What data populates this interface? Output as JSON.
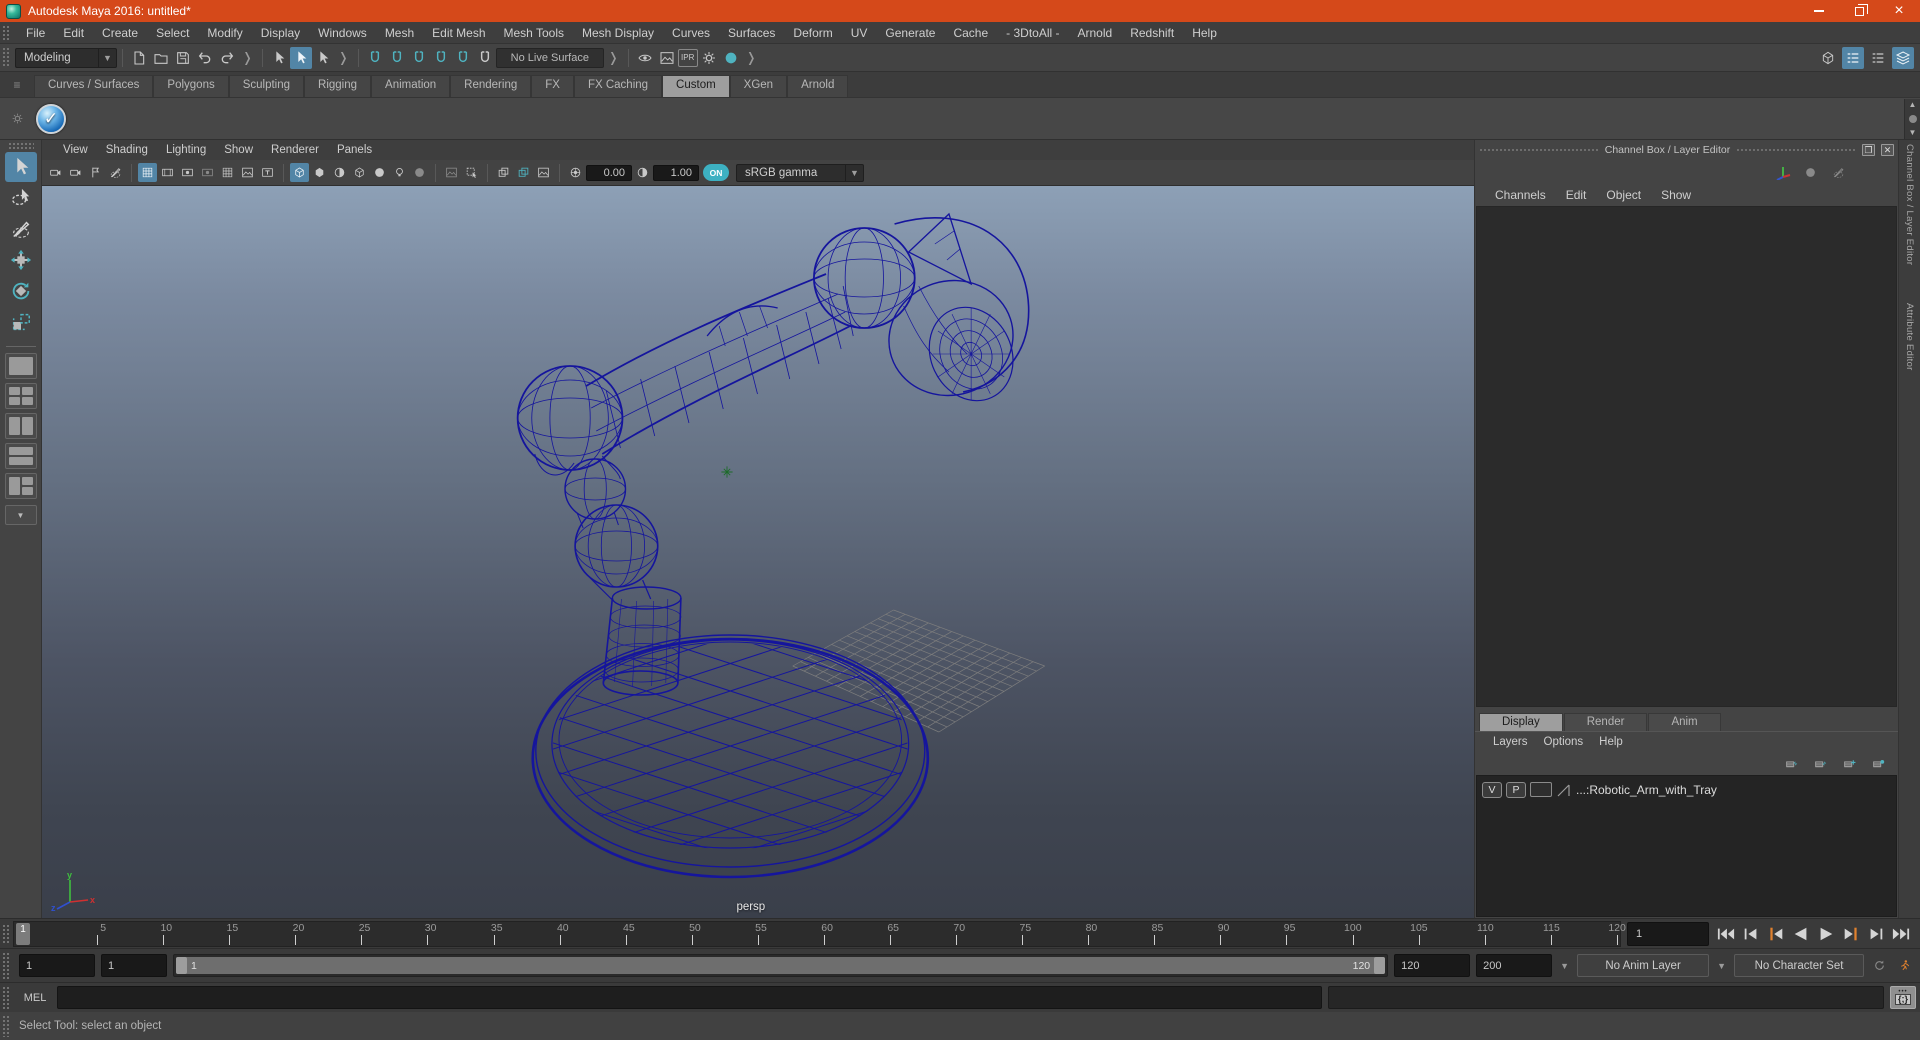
{
  "window": {
    "title": "Autodesk Maya 2016: untitled*"
  },
  "menus": [
    "File",
    "Edit",
    "Create",
    "Select",
    "Modify",
    "Display",
    "Windows",
    "Mesh",
    "Edit Mesh",
    "Mesh Tools",
    "Mesh Display",
    "Curves",
    "Surfaces",
    "Deform",
    "UV",
    "Generate",
    "Cache",
    "- 3DtoAll -",
    "Arnold",
    "Redshift",
    "Help"
  ],
  "toolbar": {
    "menu_set": "Modeling",
    "live_surface": "No Live Surface"
  },
  "shelf": {
    "tabs": [
      "Curves / Surfaces",
      "Polygons",
      "Sculpting",
      "Rigging",
      "Animation",
      "Rendering",
      "FX",
      "FX Caching",
      "Custom",
      "XGen",
      "Arnold"
    ],
    "active_tab": "Custom"
  },
  "viewport": {
    "menus": [
      "View",
      "Shading",
      "Lighting",
      "Show",
      "Renderer",
      "Panels"
    ],
    "exposure": "0.00",
    "contrast": "1.00",
    "gamma_toggle": "ON",
    "color_space": "sRGB gamma",
    "camera": "persp"
  },
  "channel_box": {
    "title": "Channel Box / Layer Editor",
    "menus": [
      "Channels",
      "Edit",
      "Object",
      "Show"
    ]
  },
  "layer_editor": {
    "tabs": [
      "Display",
      "Render",
      "Anim"
    ],
    "active_tab": "Display",
    "menus": [
      "Layers",
      "Options",
      "Help"
    ],
    "layer": {
      "visibility": "V",
      "playback": "P",
      "name": "...:Robotic_Arm_with_Tray"
    }
  },
  "right_sidebar": {
    "labels": [
      "Channel Box / Layer Editor",
      "Attribute Editor"
    ]
  },
  "timeline": {
    "ticks": [
      "5",
      "10",
      "15",
      "20",
      "25",
      "30",
      "35",
      "40",
      "45",
      "50",
      "55",
      "60",
      "65",
      "70",
      "75",
      "80",
      "85",
      "90",
      "95",
      "100",
      "105",
      "110",
      "115",
      "120"
    ],
    "current_frame": "1",
    "current_time_field": "1"
  },
  "range": {
    "anim_start": "1",
    "playback_start": "1",
    "range_start": "1",
    "range_end": "120",
    "playback_end": "120",
    "anim_end": "200",
    "anim_layer": "No Anim Layer",
    "character_set": "No Character Set"
  },
  "command_line": {
    "label": "MEL"
  },
  "help_line": {
    "text": "Select Tool: select an object"
  },
  "colors": {
    "titlebar": "#d5491a",
    "highlight_blue": "#5285a6",
    "accent_teal": "#4fb3c0",
    "wireframe_navy": "#15159d",
    "autokey_orange": "#e0812e"
  }
}
